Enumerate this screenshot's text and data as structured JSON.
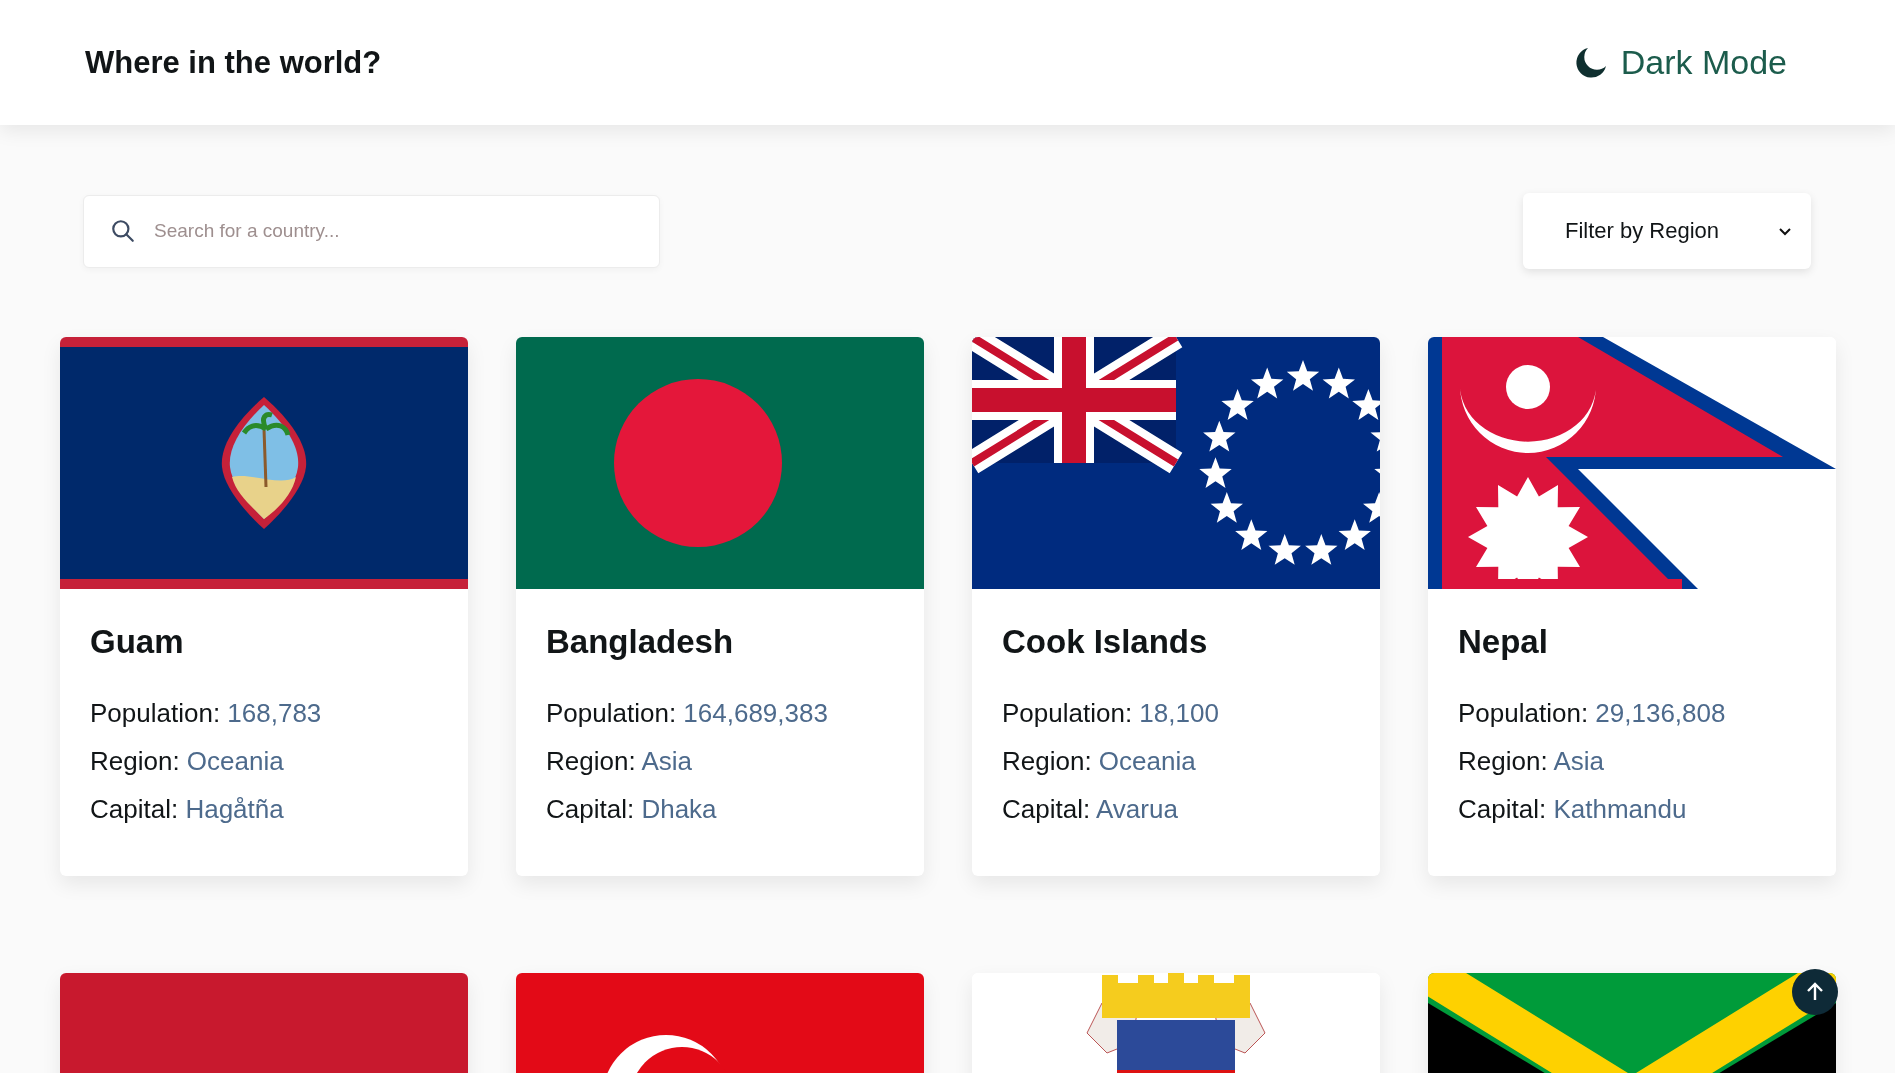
{
  "header": {
    "title": "Where in the world?",
    "theme_toggle": "Dark Mode"
  },
  "search": {
    "placeholder": "Search for a country..."
  },
  "filter": {
    "label": "Filter by Region"
  },
  "countries": [
    {
      "kind": "guam",
      "name": "Guam",
      "fields": [
        {
          "label": "Population:",
          "value": "168,783"
        },
        {
          "label": "Region:",
          "value": "Oceania"
        },
        {
          "label": "Capital:",
          "value": "Hagåtña"
        }
      ]
    },
    {
      "kind": "bangladesh",
      "name": "Bangladesh",
      "fields": [
        {
          "label": "Population:",
          "value": "164,689,383"
        },
        {
          "label": "Region:",
          "value": "Asia"
        },
        {
          "label": "Capital:",
          "value": "Dhaka"
        }
      ]
    },
    {
      "kind": "cook",
      "name": "Cook Islands",
      "fields": [
        {
          "label": "Population:",
          "value": "18,100"
        },
        {
          "label": "Region:",
          "value": "Oceania"
        },
        {
          "label": "Capital:",
          "value": "Avarua"
        }
      ]
    },
    {
      "kind": "nepal",
      "name": "Nepal",
      "fields": [
        {
          "label": "Population:",
          "value": "29,136,808"
        },
        {
          "label": "Region:",
          "value": "Asia"
        },
        {
          "label": "Capital:",
          "value": "Kathmandu"
        }
      ]
    },
    {
      "kind": "red"
    },
    {
      "kind": "crescent"
    },
    {
      "kind": "arms"
    },
    {
      "kind": "saltire"
    }
  ]
}
